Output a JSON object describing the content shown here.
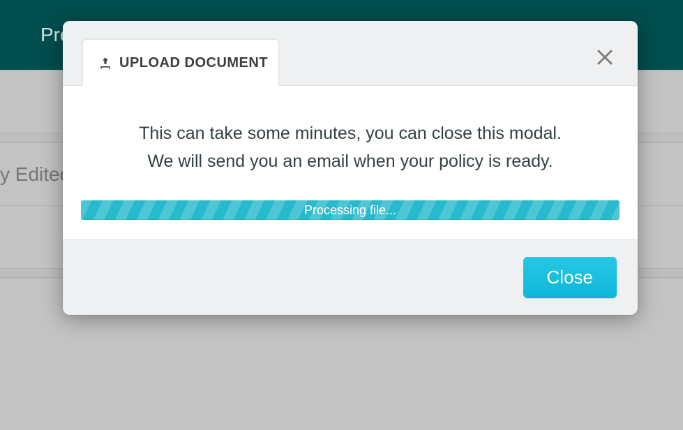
{
  "background": {
    "header_text": "Pro",
    "row_label": "y Edited"
  },
  "modal": {
    "tab_label": "UPLOAD DOCUMENT",
    "body_line1": "This can take some minutes, you can close this modal.",
    "body_line2": "We will send you an email when your policy is ready.",
    "progress_label": "Processing file...",
    "close_label": "Close"
  },
  "icons": {
    "upload": "upload-icon",
    "close_x": "close-icon"
  },
  "colors": {
    "accent": "#15bfe0",
    "header": "#004e4e"
  }
}
